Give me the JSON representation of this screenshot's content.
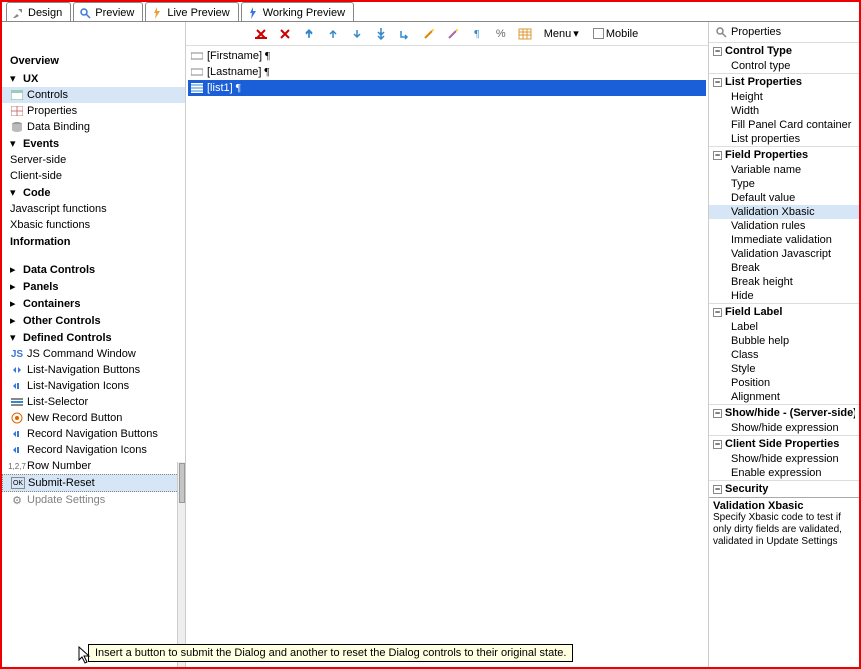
{
  "tabs": [
    {
      "label": "Design",
      "icon": "tools"
    },
    {
      "label": "Preview",
      "icon": "magnify"
    },
    {
      "label": "Live Preview",
      "icon": "bolt-orange"
    },
    {
      "label": "Working Preview",
      "icon": "bolt-blue"
    }
  ],
  "tree": {
    "overview": "Overview",
    "ux": "UX",
    "controls": "Controls",
    "properties": "Properties",
    "data_binding": "Data Binding",
    "events": "Events",
    "server_side": "Server-side",
    "client_side": "Client-side",
    "code": "Code",
    "js_functions": "Javascript functions",
    "xbasic_functions": "Xbasic functions",
    "information": "Information",
    "data_controls": "Data Controls",
    "panels": "Panels",
    "containers": "Containers",
    "other_controls": "Other Controls",
    "defined_controls": "Defined Controls",
    "js_command_window": "JS Command Window",
    "list_nav_buttons": "List-Navigation Buttons",
    "list_nav_icons": "List-Navigation Icons",
    "list_selector": "List-Selector",
    "new_record_button": "New Record Button",
    "record_nav_buttons": "Record Navigation Buttons",
    "record_nav_icons": "Record Navigation Icons",
    "row_number": "Row Number",
    "submit_reset": "Submit-Reset",
    "update_settings": "Update Settings"
  },
  "toolbar": {
    "menu": "Menu",
    "mobile": "Mobile"
  },
  "fields": [
    {
      "label": "[Firstname]",
      "selected": false,
      "icon": "field"
    },
    {
      "label": "[Lastname]",
      "selected": false,
      "icon": "field"
    },
    {
      "label": "[list1]",
      "selected": true,
      "icon": "list"
    }
  ],
  "props": {
    "title": "Properties",
    "sections": {
      "control_type": {
        "head": "Control Type",
        "items": [
          "Control type"
        ]
      },
      "list_properties": {
        "head": "List Properties",
        "items": [
          "Height",
          "Width",
          "Fill Panel Card container",
          "List properties"
        ]
      },
      "field_properties": {
        "head": "Field Properties",
        "items": [
          "Variable name",
          "Type",
          "Default value",
          "Validation Xbasic",
          "Validation rules",
          "Immediate validation",
          "Validation Javascript",
          "Break",
          "Break height",
          "Hide"
        ]
      },
      "field_label": {
        "head": "Field Label",
        "items": [
          "Label",
          "Bubble help",
          "Class",
          "Style",
          "Position",
          "Alignment"
        ]
      },
      "show_hide_server": {
        "head": "Show/hide - (Server-side)",
        "items": [
          "Show/hide expression"
        ]
      },
      "client_side": {
        "head": "Client Side Properties",
        "items": [
          "Show/hide expression",
          "Enable expression"
        ]
      },
      "security": {
        "head": "Security",
        "items": []
      }
    },
    "help": {
      "title": "Validation Xbasic",
      "body": "Specify Xbasic code to test if only dirty fields are validated, validated in Update Settings"
    }
  },
  "tooltip": "Insert a button to submit the Dialog and another to reset the Dialog controls to their original state."
}
